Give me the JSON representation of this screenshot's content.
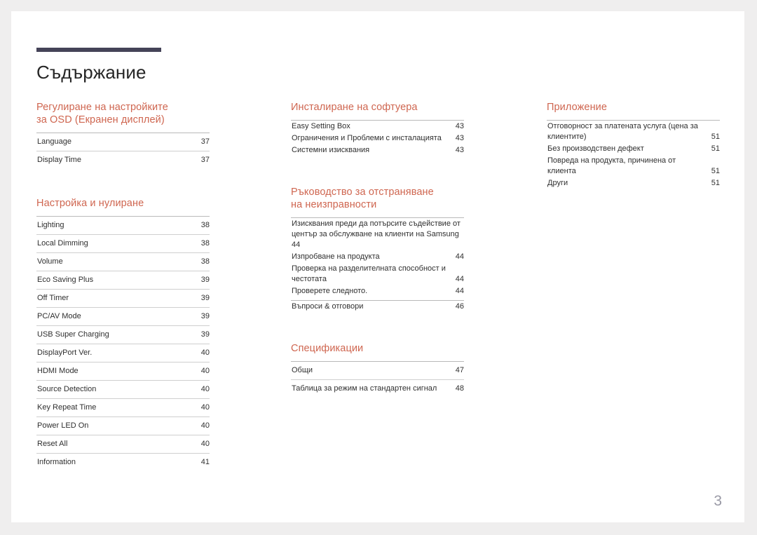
{
  "document": {
    "title": "Съдържание",
    "page_number": "3",
    "accent_color": "#cf6650",
    "rule_color": "#454358",
    "text_color": "#2f2f2f",
    "folio_color": "#9a9aa6",
    "page_background": "#ffffff",
    "canvas_background": "#efeeee"
  },
  "columns": [
    {
      "id": "column-1",
      "sections": [
        {
          "id": "osd-settings",
          "heading_lines": [
            "Регулиране на настройките",
            "за OSD (Екранен дисплей)"
          ],
          "entries": [
            {
              "label": "Language",
              "page": "37"
            },
            {
              "label": "Display Time",
              "page": "37"
            }
          ]
        },
        {
          "id": "setup-and-reset",
          "heading_lines": [
            "Настройка и нулиране"
          ],
          "entries": [
            {
              "label": "Lighting",
              "page": "38"
            },
            {
              "label": "Local Dimming",
              "page": "38"
            },
            {
              "label": "Volume",
              "page": "38"
            },
            {
              "label": "Eco Saving Plus",
              "page": "39"
            },
            {
              "label": "Off Timer",
              "page": "39"
            },
            {
              "label": "PC/AV Mode",
              "page": "39"
            },
            {
              "label": "USB Super Charging",
              "page": "39"
            },
            {
              "label": "DisplayPort Ver.",
              "page": "40"
            },
            {
              "label": "HDMI Mode",
              "page": "40"
            },
            {
              "label": "Source Detection",
              "page": "40"
            },
            {
              "label": "Key Repeat Time",
              "page": "40"
            },
            {
              "label": "Power LED On",
              "page": "40"
            },
            {
              "label": "Reset All",
              "page": "40"
            },
            {
              "label": "Information",
              "page": "41"
            }
          ]
        }
      ]
    },
    {
      "id": "column-2",
      "sections": [
        {
          "id": "software-installation",
          "heading_lines": [
            "Инсталиране на софтуера"
          ],
          "entries": [
            {
              "label": "Easy Setting Box",
              "page": "43"
            },
            {
              "label": "Ограничения и Проблеми с инсталацията",
              "page": "43"
            },
            {
              "label": "Системни изисквания",
              "page": "43"
            }
          ]
        },
        {
          "id": "troubleshooting-guide",
          "heading_lines": [
            "Ръководство за отстраняване",
            "на неизправности"
          ],
          "entries": [
            {
              "label": "Изисквания преди да потърсите съдействие от център за обслужване на клиенти на Samsung",
              "page": "44",
              "inline": true
            },
            {
              "label": "Изпробване на продукта",
              "page": "44"
            },
            {
              "label": "Проверка на разделителната способност и честотата",
              "page": "44",
              "wrap": true
            },
            {
              "label": "Проверете следното.",
              "page": "44"
            }
          ],
          "emphasis_entry": {
            "label": "Въпроси & отговори",
            "page": "46"
          }
        },
        {
          "id": "specifications",
          "heading_lines": [
            "Спецификации"
          ],
          "entries": [
            {
              "label": "Общи",
              "page": "47"
            },
            {
              "label": "Таблица за режим на стандартен сигнал",
              "page": "48"
            }
          ]
        }
      ]
    },
    {
      "id": "column-3",
      "sections": [
        {
          "id": "appendix",
          "heading_lines": [
            "Приложение"
          ],
          "entries": [
            {
              "label": "Отговорност за платената услуга (цена за клиентите)",
              "page": "51",
              "wrap": true
            },
            {
              "label": "Без производствен дефект",
              "page": "51"
            },
            {
              "label": "Повреда на продукта, причинена от клиента",
              "page": "51"
            },
            {
              "label": "Други",
              "page": "51"
            }
          ]
        }
      ]
    }
  ]
}
